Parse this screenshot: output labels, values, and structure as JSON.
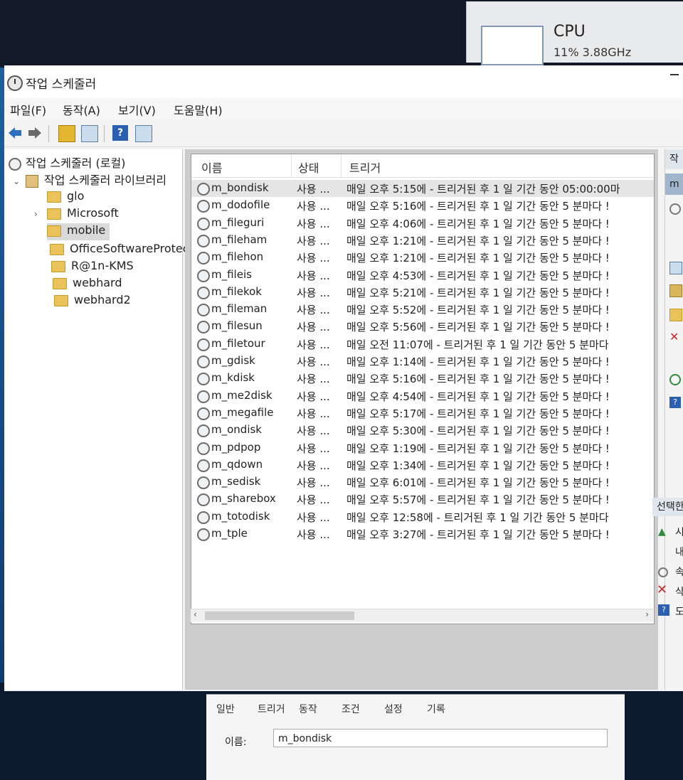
{
  "cpu": {
    "title": "CPU",
    "value": "11% 3.88GHz"
  },
  "window": {
    "title": "작업 스케줄러"
  },
  "menu": [
    "파일(F)",
    "동작(A)",
    "보기(V)",
    "도움말(H)"
  ],
  "toolbar": {
    "back": "back-arrow",
    "forward": "forward-arrow",
    "up": "up-folder",
    "show": "show-hide-console-tree",
    "help": "?",
    "pane": "action-pane"
  },
  "tree": [
    {
      "label": "작업 스케줄러 (로컬)",
      "icon": "clock-icon",
      "expander": ""
    },
    {
      "label": "작업 스케줄러 라이브러리",
      "icon": "library-icon",
      "expander": "⌄"
    },
    {
      "label": "glo",
      "icon": "folder-icon",
      "expander": ""
    },
    {
      "label": "Microsoft",
      "icon": "folder-icon",
      "expander": "›"
    },
    {
      "label": "mobile",
      "icon": "folder-icon",
      "expander": "",
      "selected": true
    },
    {
      "label": "OfficeSoftwareProtect",
      "icon": "folder-icon",
      "expander": ""
    },
    {
      "label": "R@1n-KMS",
      "icon": "folder-icon",
      "expander": ""
    },
    {
      "label": "webhard",
      "icon": "folder-icon",
      "expander": ""
    },
    {
      "label": "webhard2",
      "icon": "folder-icon",
      "expander": ""
    }
  ],
  "list": {
    "columns": [
      "이름",
      "상태",
      "트리거"
    ],
    "rows": [
      {
        "name": "m_bondisk",
        "status": "사용 ...",
        "trigger": "매일 오후 5:15에 - 트리거된 후 1 일 기간 동안 05:00:00마",
        "selected": true
      },
      {
        "name": "m_dodofile",
        "status": "사용 ...",
        "trigger": "매일 오후 5:16에 - 트리거된 후 1 일 기간 동안 5 분마다 !"
      },
      {
        "name": "m_fileguri",
        "status": "사용 ...",
        "trigger": "매일 오후 4:06에 - 트리거된 후 1 일 기간 동안 5 분마다 !"
      },
      {
        "name": "m_fileham",
        "status": "사용 ...",
        "trigger": "매일 오후 1:21에 - 트리거된 후 1 일 기간 동안 5 분마다 !"
      },
      {
        "name": "m_filehon",
        "status": "사용 ...",
        "trigger": "매일 오후 1:21에 - 트리거된 후 1 일 기간 동안 5 분마다 !"
      },
      {
        "name": "m_fileis",
        "status": "사용 ...",
        "trigger": "매일 오후 4:53에 - 트리거된 후 1 일 기간 동안 5 분마다 !"
      },
      {
        "name": "m_filekok",
        "status": "사용 ...",
        "trigger": "매일 오후 5:21에 - 트리거된 후 1 일 기간 동안 5 분마다 !"
      },
      {
        "name": "m_fileman",
        "status": "사용 ...",
        "trigger": "매일 오후 5:52에 - 트리거된 후 1 일 기간 동안 5 분마다 !"
      },
      {
        "name": "m_filesun",
        "status": "사용 ...",
        "trigger": "매일 오후 5:56에 - 트리거된 후 1 일 기간 동안 5 분마다 !"
      },
      {
        "name": "m_filetour",
        "status": "사용 ...",
        "trigger": "매일 오전 11:07에 - 트리거된 후 1 일 기간 동안 5 분마다"
      },
      {
        "name": "m_gdisk",
        "status": "사용 ...",
        "trigger": "매일 오후 1:14에 - 트리거된 후 1 일 기간 동안 5 분마다 !"
      },
      {
        "name": "m_kdisk",
        "status": "사용 ...",
        "trigger": "매일 오후 5:16에 - 트리거된 후 1 일 기간 동안 5 분마다 !"
      },
      {
        "name": "m_me2disk",
        "status": "사용 ...",
        "trigger": "매일 오후 4:54에 - 트리거된 후 1 일 기간 동안 5 분마다 !"
      },
      {
        "name": "m_megafile",
        "status": "사용 ...",
        "trigger": "매일 오후 5:17에 - 트리거된 후 1 일 기간 동안 5 분마다 !"
      },
      {
        "name": "m_ondisk",
        "status": "사용 ...",
        "trigger": "매일 오후 5:30에 - 트리거된 후 1 일 기간 동안 5 분마다 !"
      },
      {
        "name": "m_pdpop",
        "status": "사용 ...",
        "trigger": "매일 오후 1:19에 - 트리거된 후 1 일 기간 동안 5 분마다 !"
      },
      {
        "name": "m_qdown",
        "status": "사용 ...",
        "trigger": "매일 오후 1:34에 - 트리거된 후 1 일 기간 동안 5 분마다 !"
      },
      {
        "name": "m_sedisk",
        "status": "사용 ...",
        "trigger": "매일 오후 6:01에 - 트리거된 후 1 일 기간 동안 5 분마다 !"
      },
      {
        "name": "m_sharebox",
        "status": "사용 ...",
        "trigger": "매일 오후 5:57에 - 트리거된 후 1 일 기간 동안 5 분마다 !"
      },
      {
        "name": "m_totodisk",
        "status": "사용 ...",
        "trigger": "매일 오후 12:58에 - 트리거된 후 1 일 기간 동안 5 분마다"
      },
      {
        "name": "m_tple",
        "status": "사용 ...",
        "trigger": "매일 오후 3:27에 - 트리거된 후 1 일 기간 동안 5 분마다 !"
      }
    ]
  },
  "detail": {
    "tabs": [
      "일반",
      "트리거",
      "동작",
      "조건",
      "설정",
      "기록"
    ],
    "name_label": "이름:",
    "name_value": "m_bondisk"
  },
  "actions": {
    "header": "작",
    "selected": "m",
    "section": "선택한",
    "items": [
      "시",
      "내",
      "속",
      "삭",
      "도움"
    ]
  },
  "colors": {
    "accent": "#9fb6cc",
    "window_bg": "#f3f3f3",
    "desktop": "#0b1a2e"
  }
}
